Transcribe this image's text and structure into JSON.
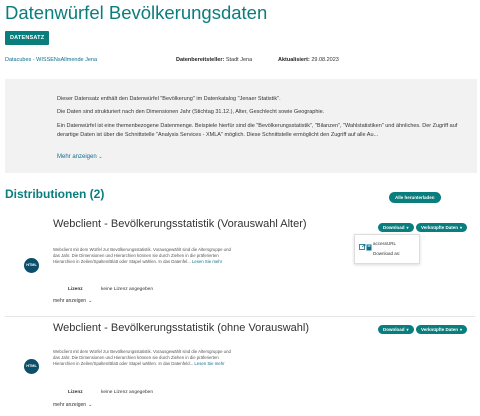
{
  "page": {
    "title": "Datenwürfel Bevölkerungsdaten",
    "badge": "DATENSATZ"
  },
  "meta": {
    "link": "Datacubes - WISSENsAllmende Jena",
    "provider_label": "Datenbereitsteller:",
    "provider_value": "Stadt Jena",
    "updated_label": "Aktualisiert:",
    "updated_value": "29.08.2023"
  },
  "description": {
    "p1": "Dieser Datensatz enthält den Datenwürfel \"Bevölkerung\" im Datenkatalog \"Jenaer Statistik\".",
    "p2": "Die Daten sind strukturiert nach den Dimensionen Jahr (Stichtag 31.12.), Alter, Geschlecht sowie Geographie.",
    "p3": "Ein Datenwürfel ist eine themenbezogene Datenmenge. Beispiele hierfür sind die \"Bevölkerungsstatistik\", \"Bilanzen\", \"Wahlstatistiken\" und ähnliches. Der Zugriff auf derartige Daten ist über die Schnittstelle \"Analysis Services - XMLA\" möglich. Diese Schnittstelle ermöglicht den Zugriff auf alle Au...",
    "more": "Mehr anzeigen"
  },
  "distributions": {
    "heading": "Distributionen (2)",
    "download_all": "Alle herunterladen",
    "items": [
      {
        "title": "Webclient - Bevölkerungsstatistik (Vorauswahl Alter)",
        "desc": "Webclient mit dem Würfel zur Bevölkerungsstatistik. Vorausgewählt sind die Altersgruppe und das Jahr. Die Dimensionen und Hierarchien können sie durch Ziehen in die präferierten Hierarchien in Zeilen/Spalten/Blatt oder Stapel wählen. In das Datenfel...",
        "read_more": "Lesen Sie mehr",
        "format": "HTML",
        "license_label": "Lizenz",
        "license_value": "keine Lizenz angegeben",
        "more": "mehr anzeigen",
        "download": "Download",
        "linked": "Verknüpfte Daten"
      },
      {
        "title": "Webclient - Bevölkerungsstatistik (ohne Vorauswahl)",
        "desc": "Webclient mit dem Würfel zur Bevölkerungsstatistik. Vorausgewählt sind die Altersgruppe und das Jahr. Die Dimensionen und Hierarchien können sie durch Ziehen in die präferierten Hierarchien in Zeilen/Spalten/Blatt oder Stapel wählen. In das Datenfeld...",
        "read_more": "Lesen Sie mehr",
        "format": "HTML",
        "license_label": "Lizenz",
        "license_value": "keine Lizenz angegeben",
        "more": "mehr anzeigen",
        "download": "Download",
        "linked": "Verknüpfte Daten"
      }
    ]
  },
  "dropdown": {
    "item1": "accessURL",
    "item2": "Download as:"
  },
  "colors": {
    "accent": "#0a7d7d",
    "link": "#0b6f8e",
    "format_icon": "#0c4f6b",
    "description_bg": "#f2f2f2"
  }
}
